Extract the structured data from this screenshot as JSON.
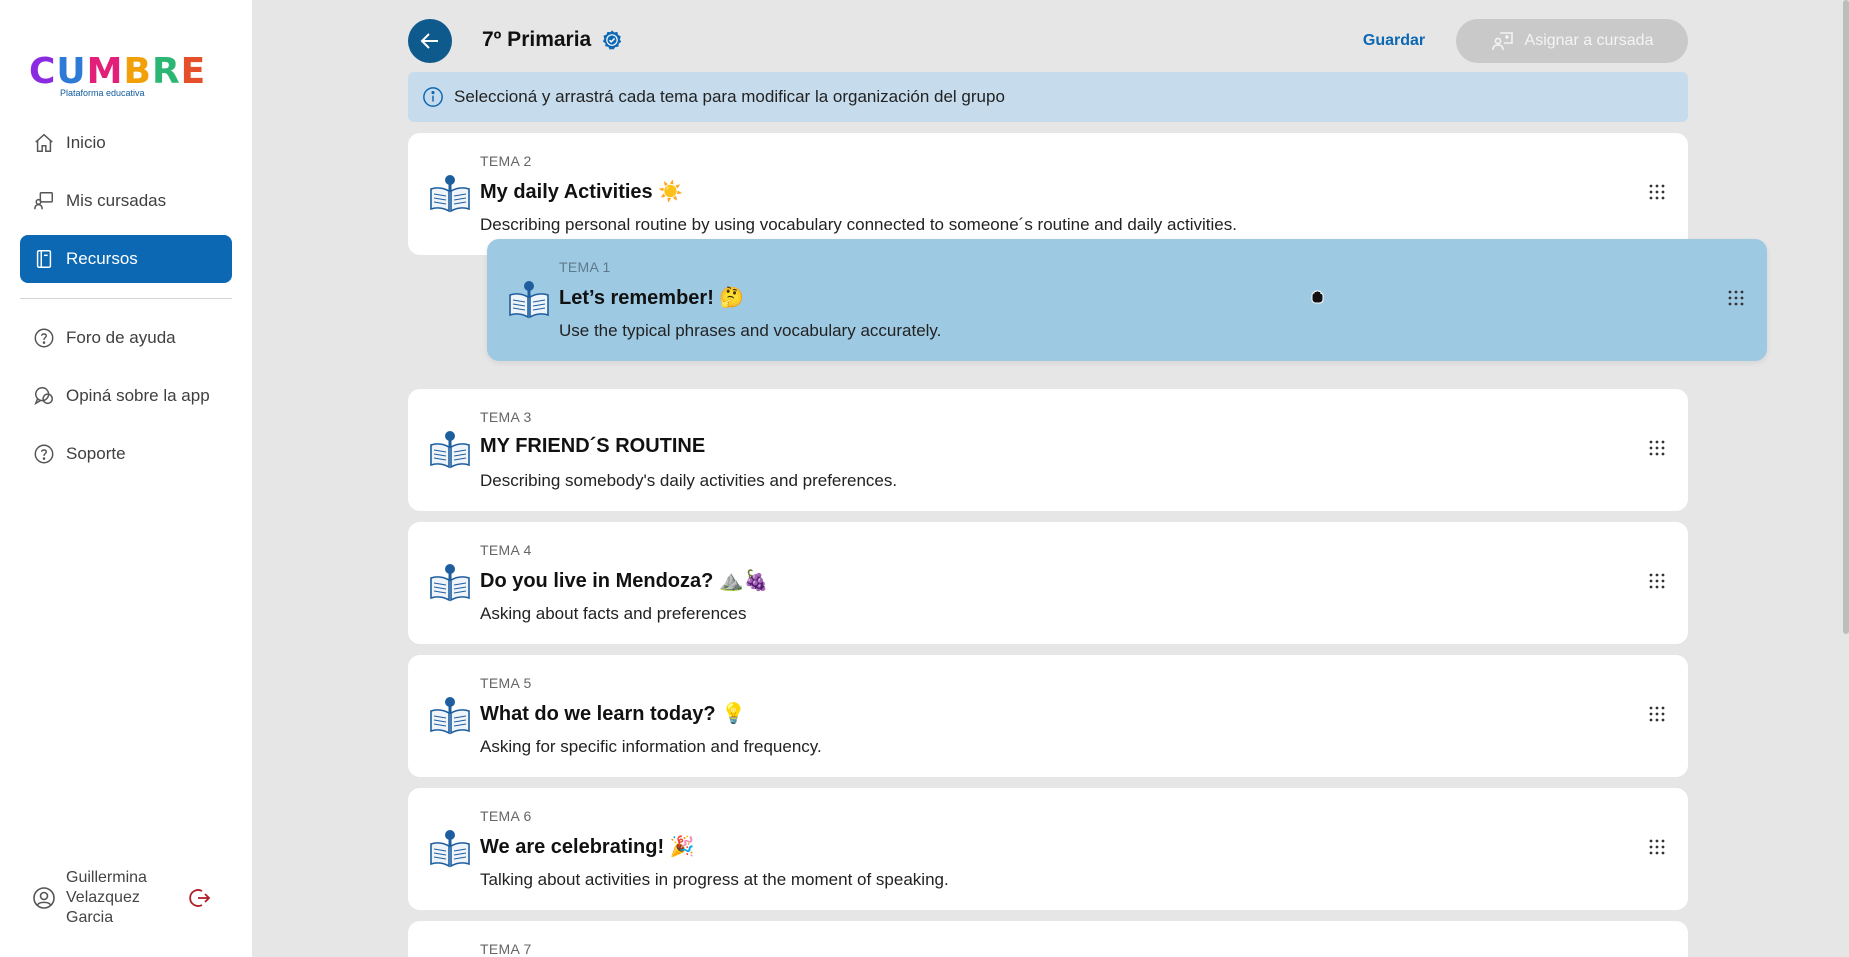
{
  "brand": {
    "logo_text": "CUMBRE",
    "logo_subtitle": "Plataforma educativa"
  },
  "sidebar": {
    "items": [
      {
        "label": "Inicio",
        "icon": "home-icon"
      },
      {
        "label": "Mis cursadas",
        "icon": "teacher-board-icon"
      },
      {
        "label": "Recursos",
        "icon": "book-icon",
        "active": true
      },
      {
        "label": "Foro de ayuda",
        "icon": "help-circle-icon"
      },
      {
        "label": "Opiná sobre la app",
        "icon": "chat-bubbles-icon"
      },
      {
        "label": "Soporte",
        "icon": "help-circle-icon"
      }
    ],
    "user": {
      "name": "Guillermina Velazquez Garcia",
      "logout_icon": "logout-icon"
    }
  },
  "header": {
    "title": "7º Primaria",
    "save_label": "Guardar",
    "assign_label": "Asignar a cursada"
  },
  "info": {
    "text": "Seleccioná y arrastrá cada tema para modificar la organización del grupo"
  },
  "topics": [
    {
      "tema": "TEMA 2",
      "title": "My daily Activities ☀️",
      "desc": "Describing personal routine by using vocabulary connected to someone´s routine and daily activities."
    },
    {
      "tema": "TEMA 1",
      "title": "Let’s remember! 🤔",
      "desc": "Use the typical phrases and vocabulary accurately."
    },
    {
      "tema": "TEMA 3",
      "title": "MY FRIEND´S ROUTINE",
      "desc": "Describing somebody's daily activities and preferences."
    },
    {
      "tema": "TEMA 4",
      "title": "Do you live in Mendoza? ⛰️🍇",
      "desc": "Asking about facts and preferences"
    },
    {
      "tema": "TEMA 5",
      "title": "What do we learn today? 💡",
      "desc": "Asking for specific information and frequency."
    },
    {
      "tema": "TEMA 6",
      "title": "We are celebrating! 🎉",
      "desc": "Talking about activities in progress at the moment of speaking."
    },
    {
      "tema": "TEMA 7",
      "title": "",
      "desc": ""
    }
  ],
  "colors": {
    "primary": "#0d68b3",
    "dark_blue": "#0f5a8d",
    "info_bg": "#c6dcec",
    "drag_bg": "#9ec9e3",
    "disabled_btn": "#c9c9c9"
  }
}
